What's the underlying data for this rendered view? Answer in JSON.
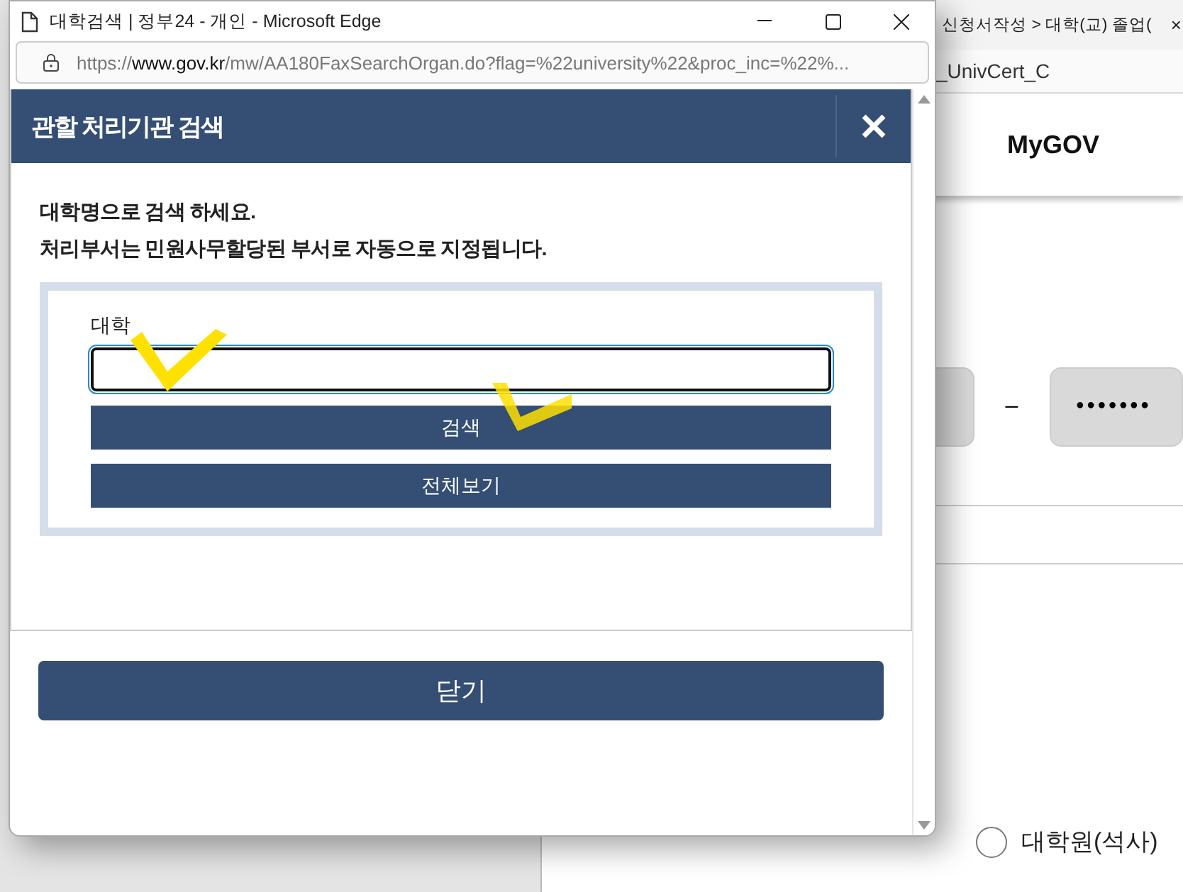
{
  "background_page": {
    "tab_title": "신청서작성 > 대학(교) 졸업(",
    "tab_close": "×",
    "address_fragment": "_UnivCert_C",
    "header_link": "MyGOV",
    "separator": "–",
    "password_dots": "•••••••",
    "radios": [
      {
        "label": "대학원(석사)",
        "selected": false
      }
    ]
  },
  "popup_window": {
    "title": "대학검색 | 정부24 - 개인 - Microsoft Edge",
    "url_scheme": "https://",
    "url_host": "www.gov.kr",
    "url_path": "/mw/AA180FaxSearchOrgan.do?flag=%22university%22&proc_inc=%22%..."
  },
  "dialog": {
    "title": "관할 처리기관 검색",
    "instructions": [
      "대학명으로 검색 하세요.",
      "처리부서는 민원사무할당된 부서로 자동으로 지정됩니다."
    ],
    "field_label": "대학",
    "buttons": [
      "검색",
      "전체보기"
    ],
    "close_button": "닫기"
  }
}
